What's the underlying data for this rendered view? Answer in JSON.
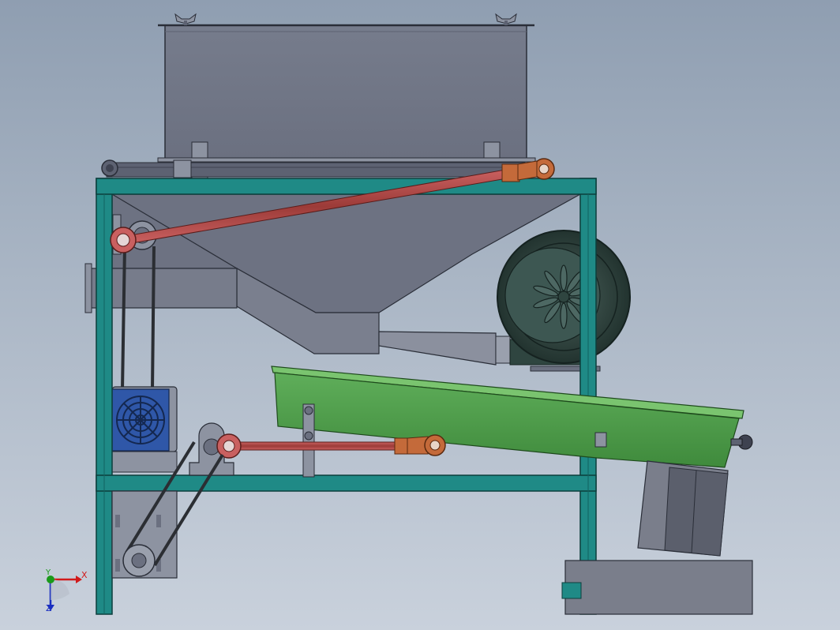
{
  "scene": {
    "view": "front",
    "background_gradient": [
      "#8f9eb1",
      "#c9d1dc"
    ],
    "colors": {
      "frame": "#1f8a86",
      "frame_edge": "#0c3e3c",
      "hopper": "#757b8b",
      "hopper_edge": "#2a2e38",
      "rod": "#b24a45",
      "rod_end": "#c46a3a",
      "screen": "#52a24f",
      "blower": "#2f4540",
      "motor": "#2f57a8",
      "belt": "#2b2e33",
      "bin": "#7a7e8b"
    },
    "components": [
      {
        "name": "hopper",
        "icon": "hopper-shape"
      },
      {
        "name": "funnel",
        "icon": "funnel-shape"
      },
      {
        "name": "frame",
        "icon": "frame-shape"
      },
      {
        "name": "upper-connecting-rod",
        "icon": "rod-shape"
      },
      {
        "name": "lower-connecting-rod",
        "icon": "rod-shape"
      },
      {
        "name": "blower-fan",
        "icon": "fan-icon"
      },
      {
        "name": "drive-motor",
        "icon": "motor-icon"
      },
      {
        "name": "vibrating-screen",
        "icon": "screen-shape"
      },
      {
        "name": "collection-bin",
        "icon": "bin-shape"
      },
      {
        "name": "drive-belt",
        "icon": "belt-shape"
      }
    ]
  },
  "axes": {
    "x_label": "X",
    "y_label": "Y",
    "z_label": "Z",
    "x_color": "#d11a1a",
    "y_color": "#1a9a1a",
    "z_color": "#1a2fc0"
  }
}
